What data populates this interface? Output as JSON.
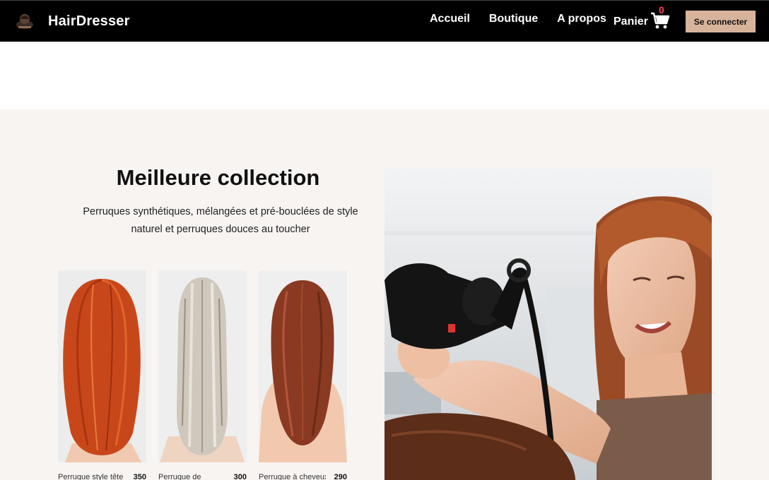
{
  "navbar": {
    "brand": "HairDresser",
    "logo_icon": "salon-logo-icon",
    "links": [
      "Accueil",
      "Boutique",
      "A propos"
    ],
    "cart_label": "Panier",
    "cart_icon": "cart-icon",
    "cart_count": "0",
    "login_label": "Se connecter",
    "colors": {
      "bg": "#000000",
      "login_bg": "#d7b39b",
      "badge": "#ff3d5a"
    }
  },
  "hero": {
    "title": "Meilleure collection",
    "subtitle": "Perruques synthétiques, mélangées et pré-bouclées de style naturel et perruques douces au toucher",
    "bg_color": "#f8f4f2"
  },
  "products": [
    {
      "name": "Perruque style tête",
      "price": "350",
      "hair_color": "#c8471a"
    },
    {
      "name": "Perruque de",
      "price": "300",
      "hair_color": "#cfc8bd"
    },
    {
      "name": "Perruque à cheveux",
      "price": "290",
      "hair_color": "#8a3a22"
    }
  ]
}
